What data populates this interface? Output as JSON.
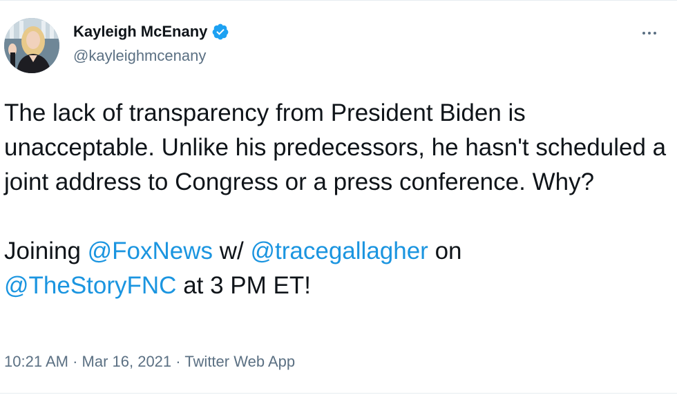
{
  "author": {
    "display_name": "Kayleigh McEnany",
    "handle": "@kayleighmcenany",
    "verified": true,
    "avatar_icon": "profile-photo"
  },
  "menu": {
    "more_icon": "more-horizontal-icon"
  },
  "tweet": {
    "paragraph1": "The lack of transparency from President Biden is unacceptable. Unlike his predecessors, he hasn't scheduled a joint address to Congress or a press conference. Why?",
    "p2_text_1": "Joining ",
    "mention_1": "@FoxNews",
    "p2_text_2": " w/ ",
    "mention_2": "@tracegallagher",
    "p2_text_3": " on ",
    "mention_3": "@TheStoryFNC",
    "p2_text_4": " at 3 PM ET!"
  },
  "meta": {
    "time": "10:21 AM",
    "separator": " · ",
    "date": "Mar 16, 2021",
    "source": "Twitter Web App"
  },
  "colors": {
    "link": "#1b95e0",
    "muted": "#5b7083",
    "text": "#0f1419",
    "verified": "#1da1f2",
    "divider": "#e6ecf0"
  }
}
